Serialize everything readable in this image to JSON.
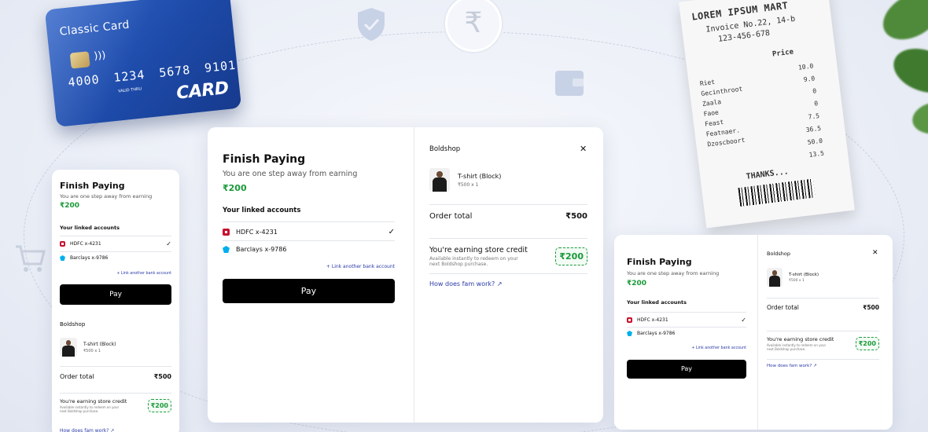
{
  "card": {
    "title": "Classic Card",
    "number": "4000 1234 5678 9101",
    "valid_thru": "VALID THRU",
    "brand": "CARD"
  },
  "receipt": {
    "store": "LOREM IPSUM MART",
    "invoice": "Invoice No.22, 14-b",
    "phone": "123-456-678",
    "price_header": "Price",
    "items": [
      "Riet",
      "Gecinthroot",
      "Zaala",
      "Faoe",
      "Feast",
      "Featnaer.",
      "Dzoscboort"
    ],
    "values": [
      "10.0",
      "9.0",
      "0",
      "0",
      "7.5",
      "36.5",
      "50.0",
      "13.5"
    ],
    "thanks": "THANKS..."
  },
  "checkout": {
    "title": "Finish Paying",
    "subtitle": "You are one step away from earning",
    "earn_amount": "₹200",
    "linked_title": "Your linked accounts",
    "accounts": [
      {
        "name": "HDFC x-4231",
        "selected": true
      },
      {
        "name": "Barclays x-9786",
        "selected": false
      }
    ],
    "link_another": "+ Link another bank account",
    "pay_label": "Pay",
    "merchant": "Boldshop",
    "product_name": "T-shirt (Block)",
    "product_meta": "₹500 x 1",
    "order_total_label": "Order total",
    "order_total_value": "₹500",
    "credit_title": "You're earning store credit",
    "credit_desc": "Available instantly to redeem on your next Boldshop purchase.",
    "credit_badge": "₹200",
    "how_link": "How does fam work?",
    "close_glyph": "✕"
  },
  "icons": {
    "rupee": "₹",
    "check": "✓",
    "external": "↗"
  },
  "colors": {
    "green": "#1a9a3a",
    "link": "#2a3aa8",
    "card_blue": "#1d4aa8"
  }
}
